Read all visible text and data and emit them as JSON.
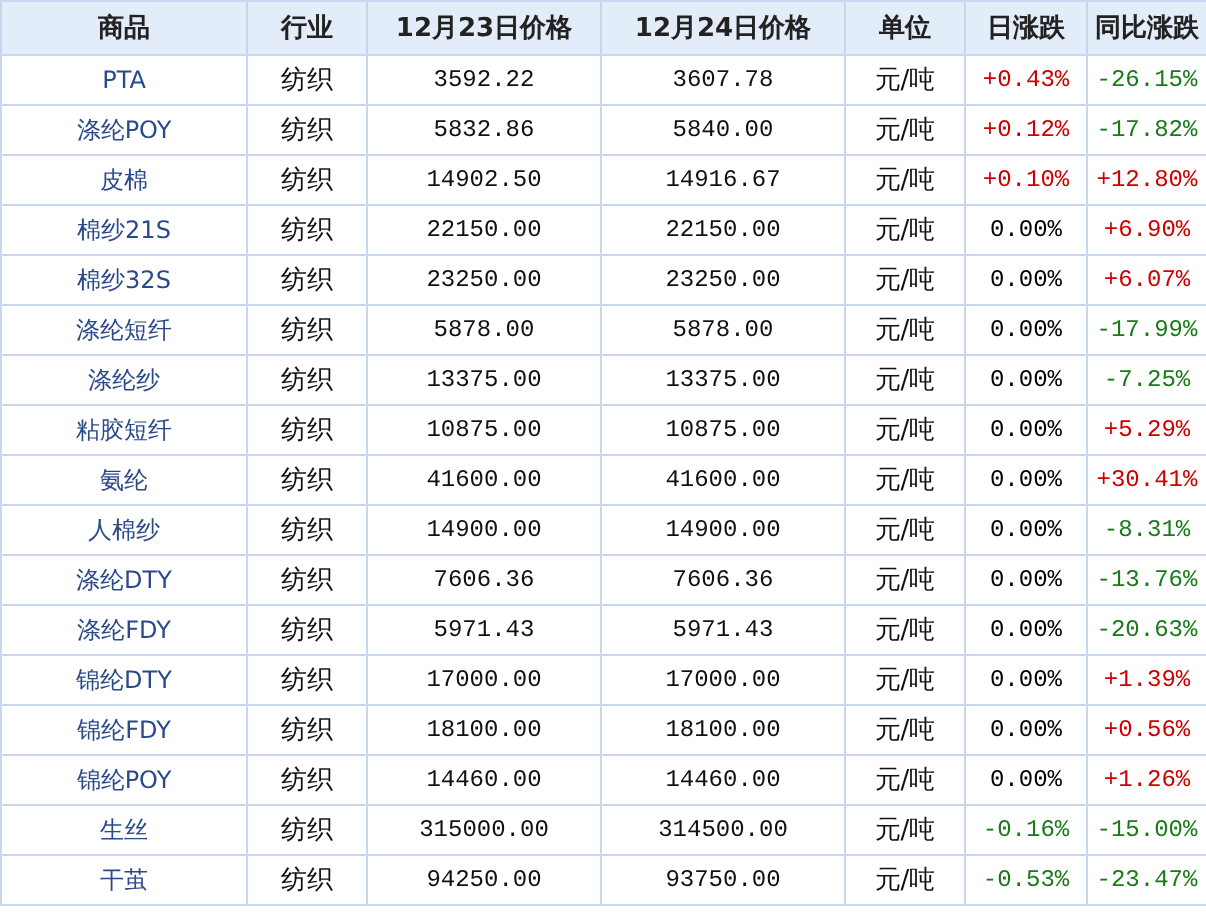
{
  "table": {
    "columns": [
      "商品",
      "行业",
      "12月23日价格",
      "12月24日价格",
      "单位",
      "日涨跌",
      "同比涨跌"
    ],
    "rows": [
      {
        "name": "PTA",
        "industry": "纺织",
        "price_prev": "3592.22",
        "price_cur": "3607.78",
        "unit": "元/吨",
        "daily": {
          "text": "+0.43%",
          "color": "#cc0000"
        },
        "yoy": {
          "text": "-26.15%",
          "color": "#1a7a1a"
        }
      },
      {
        "name": "涤纶POY",
        "industry": "纺织",
        "price_prev": "5832.86",
        "price_cur": "5840.00",
        "unit": "元/吨",
        "daily": {
          "text": "+0.12%",
          "color": "#cc0000"
        },
        "yoy": {
          "text": "-17.82%",
          "color": "#1a7a1a"
        }
      },
      {
        "name": "皮棉",
        "industry": "纺织",
        "price_prev": "14902.50",
        "price_cur": "14916.67",
        "unit": "元/吨",
        "daily": {
          "text": "+0.10%",
          "color": "#cc0000"
        },
        "yoy": {
          "text": "+12.80%",
          "color": "#cc0000"
        }
      },
      {
        "name": "棉纱21S",
        "industry": "纺织",
        "price_prev": "22150.00",
        "price_cur": "22150.00",
        "unit": "元/吨",
        "daily": {
          "text": "0.00%",
          "color": "#000000"
        },
        "yoy": {
          "text": "+6.90%",
          "color": "#cc0000"
        }
      },
      {
        "name": "棉纱32S",
        "industry": "纺织",
        "price_prev": "23250.00",
        "price_cur": "23250.00",
        "unit": "元/吨",
        "daily": {
          "text": "0.00%",
          "color": "#000000"
        },
        "yoy": {
          "text": "+6.07%",
          "color": "#cc0000"
        }
      },
      {
        "name": "涤纶短纤",
        "industry": "纺织",
        "price_prev": "5878.00",
        "price_cur": "5878.00",
        "unit": "元/吨",
        "daily": {
          "text": "0.00%",
          "color": "#000000"
        },
        "yoy": {
          "text": "-17.99%",
          "color": "#1a7a1a"
        }
      },
      {
        "name": "涤纶纱",
        "industry": "纺织",
        "price_prev": "13375.00",
        "price_cur": "13375.00",
        "unit": "元/吨",
        "daily": {
          "text": "0.00%",
          "color": "#000000"
        },
        "yoy": {
          "text": "-7.25%",
          "color": "#1a7a1a"
        }
      },
      {
        "name": "粘胶短纤",
        "industry": "纺织",
        "price_prev": "10875.00",
        "price_cur": "10875.00",
        "unit": "元/吨",
        "daily": {
          "text": "0.00%",
          "color": "#000000"
        },
        "yoy": {
          "text": "+5.29%",
          "color": "#cc0000"
        }
      },
      {
        "name": "氨纶",
        "industry": "纺织",
        "price_prev": "41600.00",
        "price_cur": "41600.00",
        "unit": "元/吨",
        "daily": {
          "text": "0.00%",
          "color": "#000000"
        },
        "yoy": {
          "text": "+30.41%",
          "color": "#cc0000"
        }
      },
      {
        "name": "人棉纱",
        "industry": "纺织",
        "price_prev": "14900.00",
        "price_cur": "14900.00",
        "unit": "元/吨",
        "daily": {
          "text": "0.00%",
          "color": "#000000"
        },
        "yoy": {
          "text": "-8.31%",
          "color": "#1a7a1a"
        }
      },
      {
        "name": "涤纶DTY",
        "industry": "纺织",
        "price_prev": "7606.36",
        "price_cur": "7606.36",
        "unit": "元/吨",
        "daily": {
          "text": "0.00%",
          "color": "#000000"
        },
        "yoy": {
          "text": "-13.76%",
          "color": "#1a7a1a"
        }
      },
      {
        "name": "涤纶FDY",
        "industry": "纺织",
        "price_prev": "5971.43",
        "price_cur": "5971.43",
        "unit": "元/吨",
        "daily": {
          "text": "0.00%",
          "color": "#000000"
        },
        "yoy": {
          "text": "-20.63%",
          "color": "#1a7a1a"
        }
      },
      {
        "name": "锦纶DTY",
        "industry": "纺织",
        "price_prev": "17000.00",
        "price_cur": "17000.00",
        "unit": "元/吨",
        "daily": {
          "text": "0.00%",
          "color": "#000000"
        },
        "yoy": {
          "text": "+1.39%",
          "color": "#cc0000"
        }
      },
      {
        "name": "锦纶FDY",
        "industry": "纺织",
        "price_prev": "18100.00",
        "price_cur": "18100.00",
        "unit": "元/吨",
        "daily": {
          "text": "0.00%",
          "color": "#000000"
        },
        "yoy": {
          "text": "+0.56%",
          "color": "#cc0000"
        }
      },
      {
        "name": "锦纶POY",
        "industry": "纺织",
        "price_prev": "14460.00",
        "price_cur": "14460.00",
        "unit": "元/吨",
        "daily": {
          "text": "0.00%",
          "color": "#000000"
        },
        "yoy": {
          "text": "+1.26%",
          "color": "#cc0000"
        }
      },
      {
        "name": "生丝",
        "industry": "纺织",
        "price_prev": "315000.00",
        "price_cur": "314500.00",
        "unit": "元/吨",
        "daily": {
          "text": "-0.16%",
          "color": "#1a7a1a"
        },
        "yoy": {
          "text": "-15.00%",
          "color": "#1a7a1a"
        }
      },
      {
        "name": "干茧",
        "industry": "纺织",
        "price_prev": "94250.00",
        "price_cur": "93750.00",
        "unit": "元/吨",
        "daily": {
          "text": "-0.53%",
          "color": "#1a7a1a"
        },
        "yoy": {
          "text": "-23.47%",
          "color": "#1a7a1a"
        }
      }
    ]
  }
}
